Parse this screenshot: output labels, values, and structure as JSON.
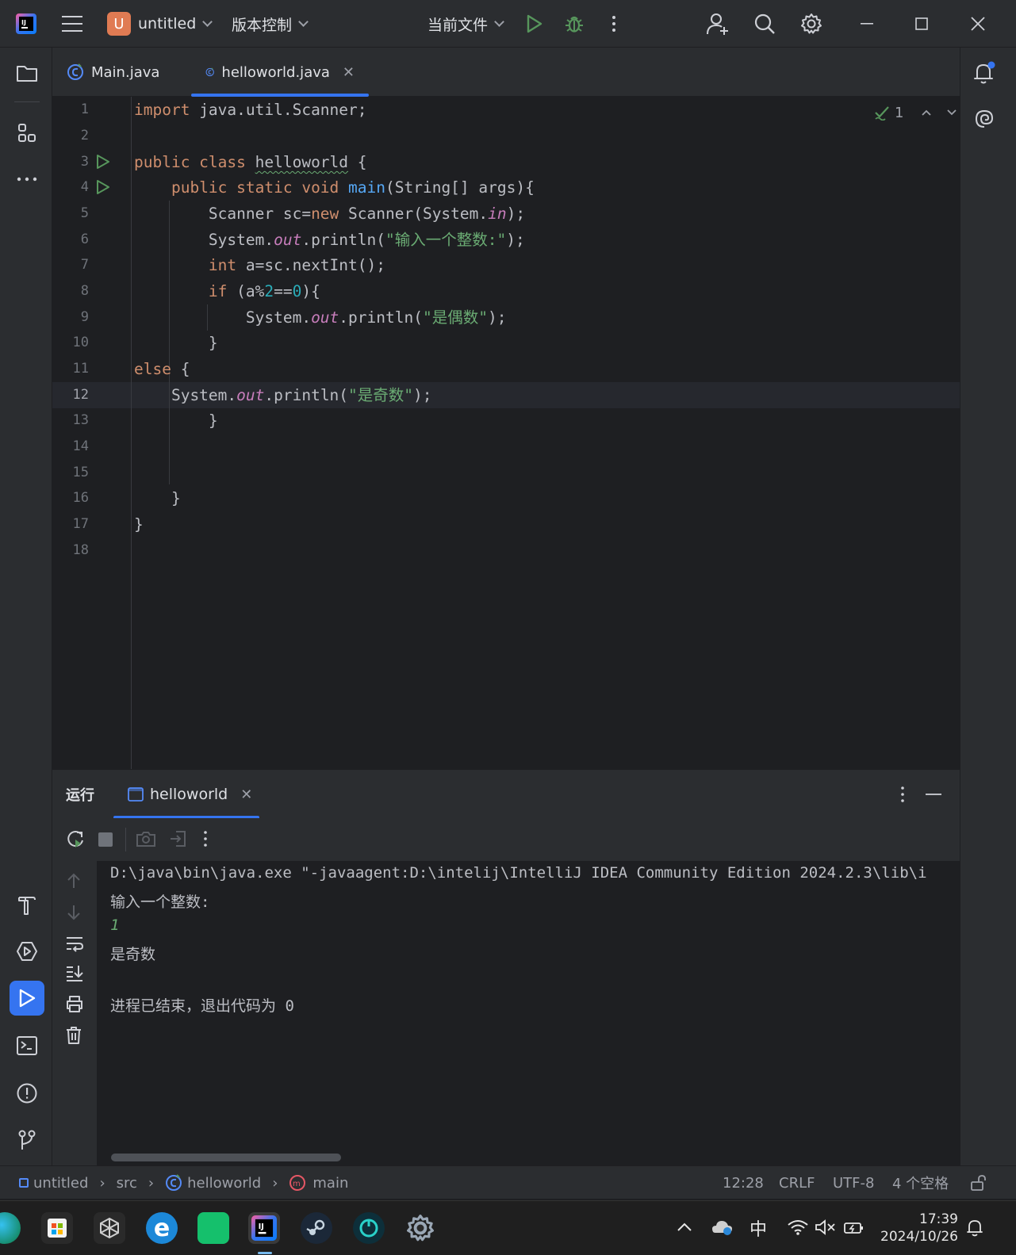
{
  "titlebar": {
    "project_badge": "U",
    "project_name": "untitled",
    "vcs": "版本控制",
    "run_config": "当前文件"
  },
  "tabs": [
    {
      "label": "Main.java"
    },
    {
      "label": "helloworld.java"
    }
  ],
  "inspection": {
    "count": "1"
  },
  "editor": {
    "line_numbers": [
      "1",
      "2",
      "3",
      "4",
      "5",
      "6",
      "7",
      "8",
      "9",
      "10",
      "11",
      "12",
      "13",
      "14",
      "15",
      "16",
      "17",
      "18"
    ],
    "current_line": 12
  },
  "run_panel": {
    "title": "运行",
    "tab_label": "helloworld",
    "console": [
      "D:\\java\\bin\\java.exe \"-javaagent:D:\\intelij\\IntelliJ IDEA Community Edition 2024.2.3\\lib\\i",
      "输入一个整数:",
      "1",
      "是奇数",
      "",
      "进程已结束，退出代码为 0"
    ]
  },
  "statusbar": {
    "project": "untitled",
    "src": "src",
    "file": "helloworld",
    "method": "main",
    "position": "12:28",
    "line_sep": "CRLF",
    "encoding": "UTF-8",
    "indent": "4 个空格"
  },
  "taskbar": {
    "time": "17:39",
    "date": "2024/10/26",
    "ime": "中"
  },
  "colors": {
    "accent": "#3574f0",
    "keyword": "#cf8e6d",
    "string": "#6aab73",
    "function": "#56a8f5",
    "number": "#2aacb8",
    "static_field": "#c77dbb"
  }
}
